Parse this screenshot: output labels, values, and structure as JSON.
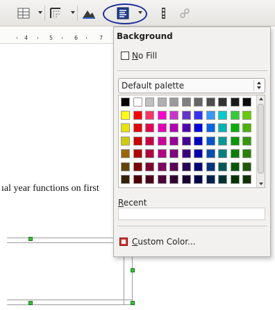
{
  "toolbar": {
    "buttons": [
      {
        "icon": "table-insert-icon"
      },
      {
        "icon": "table-borders-icon"
      },
      {
        "icon": "image-icon"
      },
      {
        "icon": "background-color-icon",
        "active": true
      },
      {
        "icon": "column-bar-icon"
      },
      {
        "icon": "link-icon"
      }
    ]
  },
  "ruler": {
    "numbers": [
      "4",
      "5",
      "6",
      "7"
    ]
  },
  "document": {
    "text": "ıal year functions on first"
  },
  "background_popup": {
    "title": "Background",
    "no_fill_label": "No Fill",
    "palette_select_value": "Default palette",
    "recent_label": "Recent",
    "custom_color_label": "Custom Color...",
    "palette_rows": [
      [
        "#000000",
        "#ffffff",
        "#c0c0c0",
        "#b0b0b0",
        "#9a9a9a",
        "#808080",
        "#666666",
        "#4d4d4d",
        "#333333",
        "#1a1a1a",
        "#0d0d0d"
      ],
      [
        "#ffff00",
        "#ff0000",
        "#ff3366",
        "#ff00cc",
        "#cc33cc",
        "#6633cc",
        "#3333ff",
        "#3399ff",
        "#00cccc",
        "#33cc33",
        "#66cc00"
      ],
      [
        "#e6e600",
        "#e60000",
        "#e6004d",
        "#e600b3",
        "#b300b3",
        "#5200b3",
        "#0000e6",
        "#0066e6",
        "#00b3b3",
        "#00b300",
        "#4db300"
      ],
      [
        "#cccc00",
        "#cc0000",
        "#cc0044",
        "#cc0099",
        "#990099",
        "#440099",
        "#0000cc",
        "#0055cc",
        "#009999",
        "#009900",
        "#339900"
      ],
      [
        "#996600",
        "#b30000",
        "#b3003c",
        "#b30086",
        "#800080",
        "#3a0080",
        "#0000b3",
        "#004db3",
        "#008080",
        "#008000",
        "#2b8000"
      ],
      [
        "#664400",
        "#800000",
        "#80002b",
        "#800060",
        "#590059",
        "#290059",
        "#000080",
        "#003380",
        "#005959",
        "#005900",
        "#1f5900"
      ],
      [
        "#332200",
        "#4d0000",
        "#4d001a",
        "#4d003a",
        "#330033",
        "#190033",
        "#00004d",
        "#001f4d",
        "#003333",
        "#003300",
        "#123300"
      ]
    ]
  }
}
